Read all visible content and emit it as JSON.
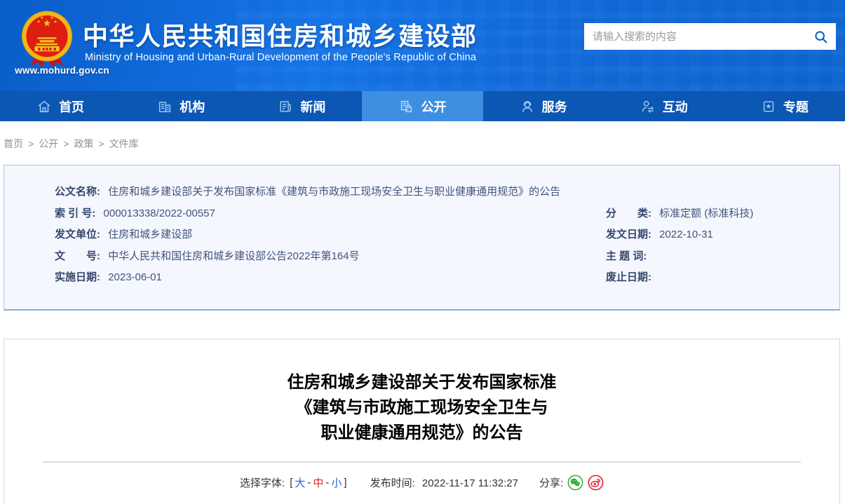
{
  "colors": {
    "header_blue": "#1168d6",
    "nav_blue": "#0b57b3",
    "nav_active_blue": "#3e8fe2",
    "search_icon_blue": "#1065c8",
    "meta_box_bg": "#f4f7fd",
    "meta_box_border": "#a9c5e8",
    "link_blue": "#2063d8",
    "font_medium_red": "#e02a1c",
    "wechat_green": "#35ab33",
    "weibo_red": "#e6162d"
  },
  "header": {
    "site_url": "www.mohurd.gov.cn",
    "title": "中华人民共和国住房和城乡建设部",
    "subtitle": "Ministry of Housing and Urban-Rural Development of the People's Republic of China",
    "search_placeholder": "请输入搜索的内容"
  },
  "nav": {
    "items": [
      {
        "label": "首页",
        "icon": "home-icon",
        "active": false
      },
      {
        "label": "机构",
        "icon": "organization-icon",
        "active": false
      },
      {
        "label": "新闻",
        "icon": "news-icon",
        "active": false
      },
      {
        "label": "公开",
        "icon": "disclosure-icon",
        "active": true
      },
      {
        "label": "服务",
        "icon": "service-icon",
        "active": false
      },
      {
        "label": "互动",
        "icon": "interaction-icon",
        "active": false
      },
      {
        "label": "专题",
        "icon": "topics-icon",
        "active": false
      }
    ]
  },
  "breadcrumb": {
    "separator": ">",
    "items": [
      "首页",
      "公开",
      "政策",
      "文件库"
    ]
  },
  "doc_meta": {
    "name_label": "公文名称:",
    "name_value": "住房和城乡建设部关于发布国家标准《建筑与市政施工现场安全卫生与职业健康通用规范》的公告",
    "rows": [
      {
        "left_label": "索 引 号:",
        "left_value": "000013338/2022-00557",
        "right_label": "分　　类:",
        "right_value": "标准定额 (标准科技)"
      },
      {
        "left_label": "发文单位:",
        "left_value": "住房和城乡建设部",
        "right_label": "发文日期:",
        "right_value": "2022-10-31"
      },
      {
        "left_label": "文　　号:",
        "left_value": "中华人民共和国住房和城乡建设部公告2022年第164号",
        "right_label": "主 题 词:",
        "right_value": ""
      },
      {
        "left_label": "实施日期:",
        "left_value": "2023-06-01",
        "right_label": "废止日期:",
        "right_value": ""
      }
    ]
  },
  "article": {
    "title_lines": [
      "住房和城乡建设部关于发布国家标准",
      "《建筑与市政施工现场安全卫生与",
      "职业健康通用规范》的公告"
    ],
    "toolbar": {
      "font_label": "选择字体:",
      "bracket_open": "[",
      "font_large": "大",
      "dash1": "-",
      "font_medium": "中",
      "dash2": "-",
      "font_small": "小",
      "bracket_close": "]",
      "publish_label": "发布时间:",
      "publish_time": "2022-11-17 11:32:27",
      "share_label": "分享:"
    }
  }
}
